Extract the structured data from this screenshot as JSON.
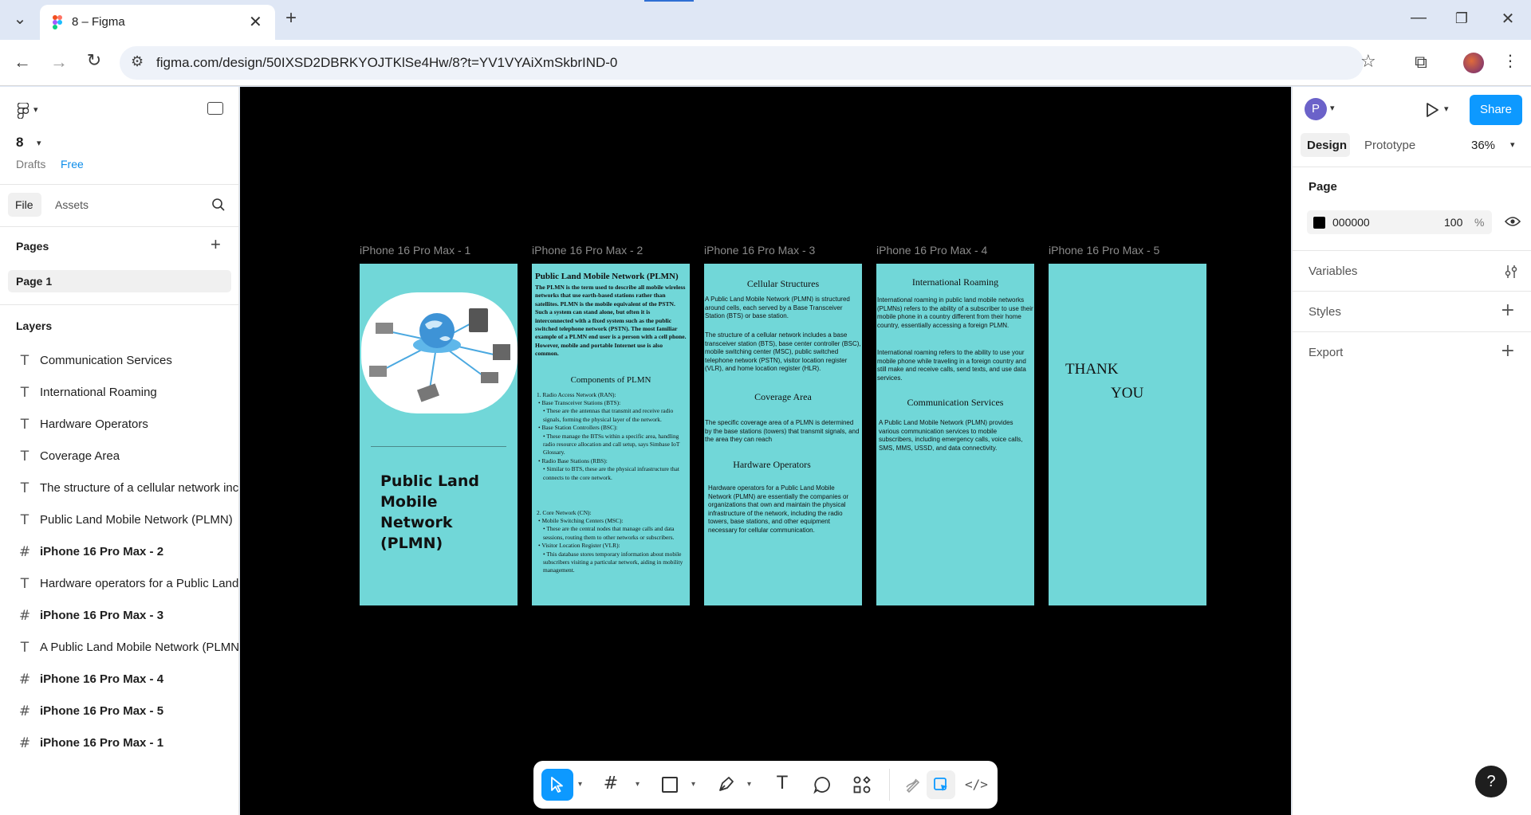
{
  "browser": {
    "tab_title": "8 – Figma",
    "url": "figma.com/design/50IXSD2DBRKYOJTKlSe4Hw/8?t=YV1VYAiXmSkbrIND-0"
  },
  "left_panel": {
    "file_name": "8",
    "drafts": "Drafts",
    "plan": "Free",
    "tabs": {
      "file": "File",
      "assets": "Assets"
    },
    "pages_heading": "Pages",
    "pages": [
      "Page 1"
    ],
    "layers_heading": "Layers",
    "layers": [
      {
        "type": "text",
        "label": "Communication Services",
        "bold": false
      },
      {
        "type": "text",
        "label": "International Roaming",
        "bold": false
      },
      {
        "type": "text",
        "label": "Hardware Operators",
        "bold": false
      },
      {
        "type": "text",
        "label": "Coverage Area",
        "bold": false
      },
      {
        "type": "text",
        "label": "The structure of a cellular network inc",
        "bold": false
      },
      {
        "type": "text",
        "label": "Public Land Mobile Network (PLMN)",
        "bold": false
      },
      {
        "type": "frame",
        "label": "iPhone 16 Pro Max - 2",
        "bold": true
      },
      {
        "type": "text",
        "label": "Hardware operators for a Public Land",
        "bold": false
      },
      {
        "type": "frame",
        "label": "iPhone 16 Pro Max - 3",
        "bold": true
      },
      {
        "type": "text",
        "label": "A Public Land Mobile Network (PLMN)",
        "bold": false
      },
      {
        "type": "frame",
        "label": "iPhone 16 Pro Max - 4",
        "bold": true
      },
      {
        "type": "frame",
        "label": "iPhone 16 Pro Max - 5",
        "bold": true
      },
      {
        "type": "frame",
        "label": "iPhone 16 Pro Max - 1",
        "bold": true
      }
    ]
  },
  "canvas": {
    "background": "#000000",
    "frame_color": "#71d7d8",
    "frames": {
      "f1": {
        "title": "iPhone 16 Pro Max - 1",
        "heading": "Public Land Mobile Network (PLMN)"
      },
      "f2": {
        "title": "iPhone 16 Pro Max - 2",
        "heading": "Public Land Mobile Network (PLMN)",
        "intro": "The PLMN is the term used to describe all mobile wireless networks that use earth-based stations rather than satellites. PLMN is the mobile equivalent of the PSTN. Such a system can stand alone, but often it is interconnected with a fixed system such as the public switched telephone network (PSTN). The most familiar example of a PLMN end user is a person with a cell phone. However, mobile and portable Internet use is also common.",
        "components_heading": "Components of PLMN",
        "ran_title": "1. Radio Access Network (RAN):",
        "ran_items": [
          "Base Transceiver Stations (BTS):",
          "These are the antennas that transmit and receive radio signals, forming the physical layer of the network.",
          "Base Station Controllers (BSC):",
          "These manage the BTSs within a specific area, handling radio resource allocation and call setup, says Simbase IoT Glossary.",
          "Radio Base Stations (RBS):",
          "Similar to BTS, these are the physical infrastructure that connects to the core network."
        ],
        "cn_title": "2. Core Network (CN):",
        "cn_items": [
          "Mobile Switching Centers (MSC):",
          "These are the central nodes that manage calls and data sessions, routing them to other networks or subscribers.",
          "Visitor Location Register (VLR):",
          "This database stores temporary information about mobile subscribers visiting a particular network, aiding in mobility management."
        ]
      },
      "f3": {
        "title": "iPhone 16 Pro Max - 3",
        "h1": "Cellular Structures",
        "p1": "A Public Land Mobile Network (PLMN) is structured around cells, each served by a Base Transceiver Station (BTS) or base station.",
        "p2": "The structure of a cellular network includes a base transceiver station (BTS), base center controller (BSC), mobile switching center (MSC), public switched telephone network (PSTN), visitor location register (VLR), and home location register (HLR).",
        "h2": "Coverage Area",
        "p3": "The specific coverage area of a PLMN is determined by the base stations (towers) that transmit signals, and the area they can reach",
        "h3": "Hardware Operators",
        "p4": "Hardware operators for a Public Land Mobile Network (PLMN) are essentially the companies or organizations that own and maintain the physical infrastructure of the network, including the radio towers, base stations, and other equipment necessary for cellular communication."
      },
      "f4": {
        "title": "iPhone 16 Pro Max - 4",
        "h1": "International Roaming",
        "p1": "International roaming in public land mobile networks (PLMNs) refers to the ability of a subscriber to use their mobile phone in a country different from their home country, essentially accessing a foreign PLMN.",
        "p2": "International roaming refers to the ability to use your mobile phone while traveling in a foreign country and still make and receive calls, send texts, and use data services.",
        "h2": "Communication Services",
        "p3": "A Public Land Mobile Network (PLMN) provides various communication services to mobile subscribers, including emergency calls, voice calls, SMS, MMS, USSD, and data connectivity."
      },
      "f5": {
        "title": "iPhone 16 Pro Max - 5",
        "line1": "THANK",
        "line2": "YOU"
      }
    }
  },
  "toolbar": {
    "tools": [
      "move-tool",
      "frame-tool",
      "shape-tool",
      "pen-tool",
      "text-tool",
      "comment-tool",
      "actions-tool",
      "draw-mode",
      "design-mode",
      "dev-mode"
    ]
  },
  "right_panel": {
    "avatar_letter": "P",
    "share": "Share",
    "tabs": {
      "design": "Design",
      "prototype": "Prototype"
    },
    "zoom": "36%",
    "page_heading": "Page",
    "page_color_hex": "000000",
    "page_color": "#000000",
    "page_opacity": "100",
    "percent": "%",
    "variables": "Variables",
    "styles": "Styles",
    "export": "Export",
    "help": "?"
  }
}
